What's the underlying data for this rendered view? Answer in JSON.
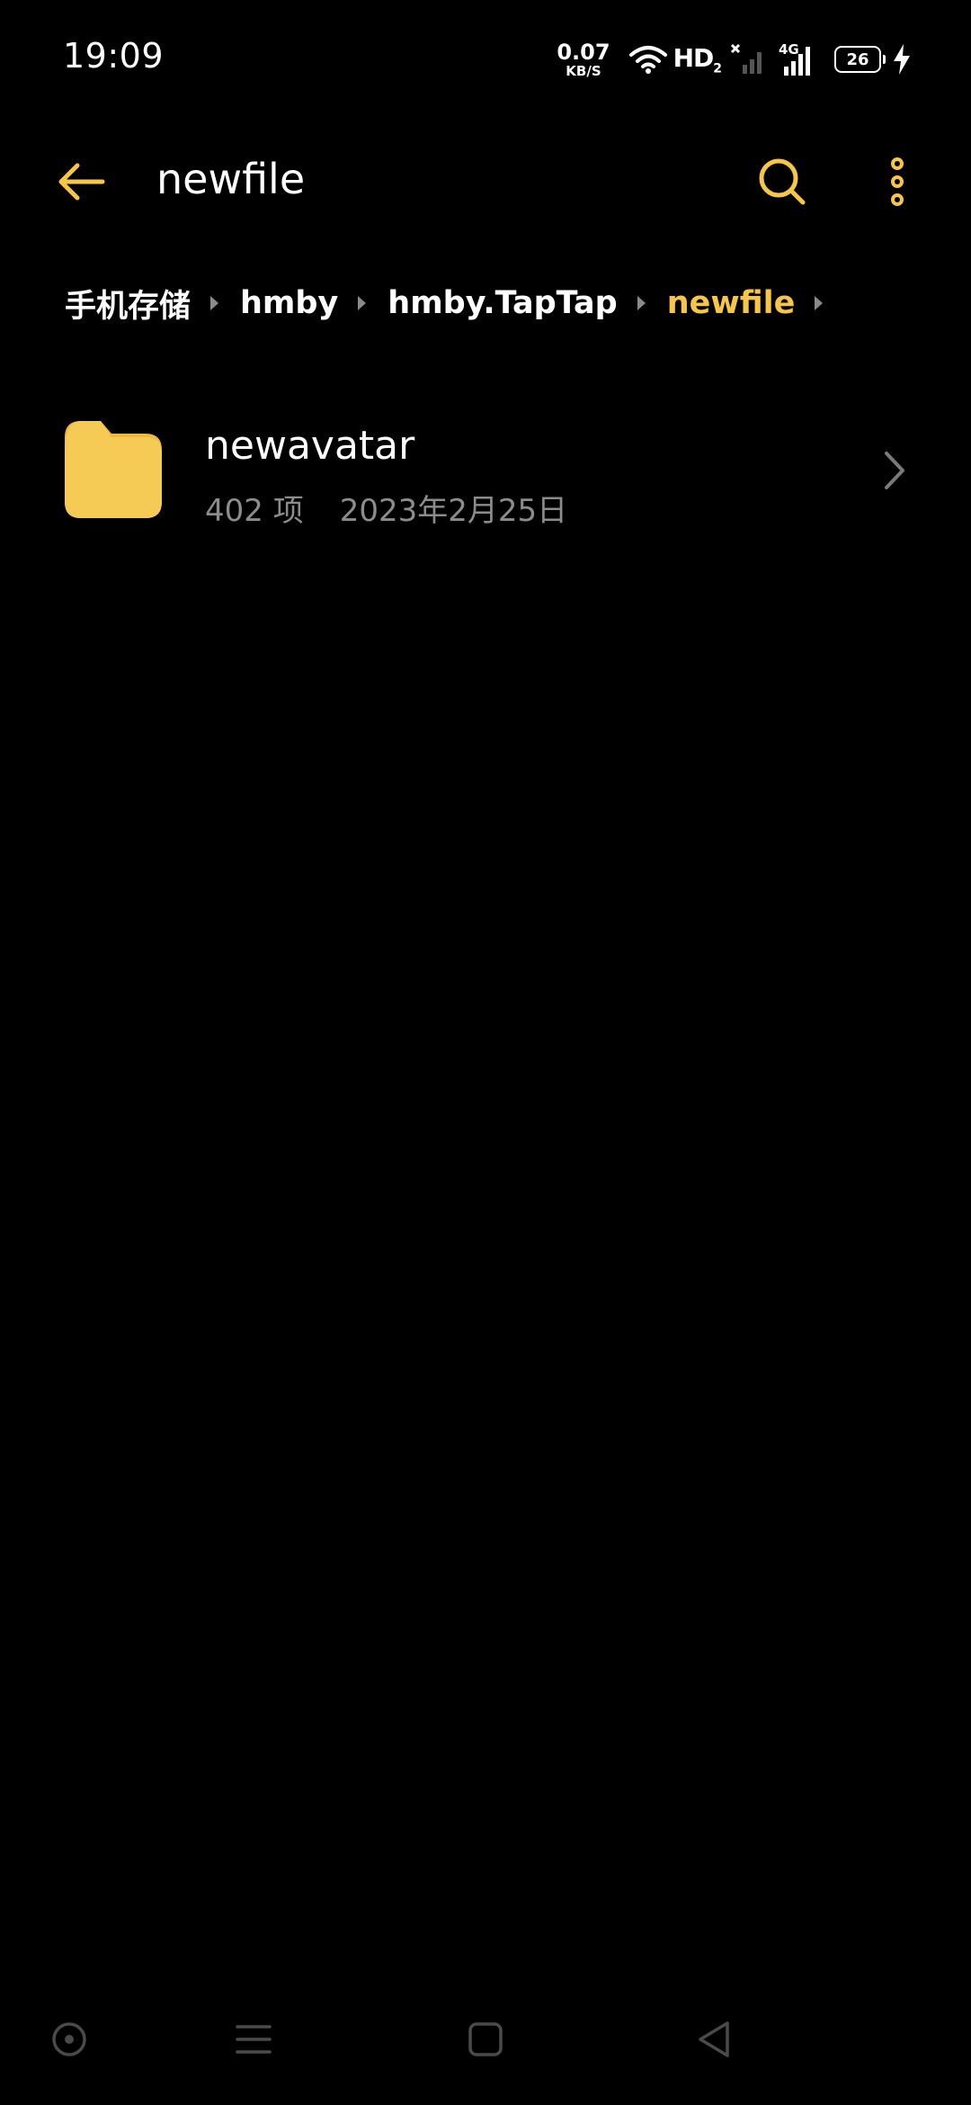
{
  "status_bar": {
    "time": "19:09",
    "net_speed_value": "0.07",
    "net_speed_unit": "KB/S",
    "hd_label": "HD",
    "hd_sub": "2",
    "network_type": "4G",
    "battery_level": "26"
  },
  "toolbar": {
    "title": "newfile"
  },
  "breadcrumb": {
    "items": [
      {
        "label": "手机存储"
      },
      {
        "label": "hmby"
      },
      {
        "label": "hmby.TapTap"
      },
      {
        "label": "newfile"
      }
    ]
  },
  "files": [
    {
      "name": "newavatar",
      "item_count": "402 项",
      "date": "2023年2月25日"
    }
  ],
  "colors": {
    "accent": "#f7c645",
    "background": "#000000",
    "text_primary": "#ffffff",
    "text_secondary": "#8c8c8c",
    "folder": "#f6cb55"
  }
}
